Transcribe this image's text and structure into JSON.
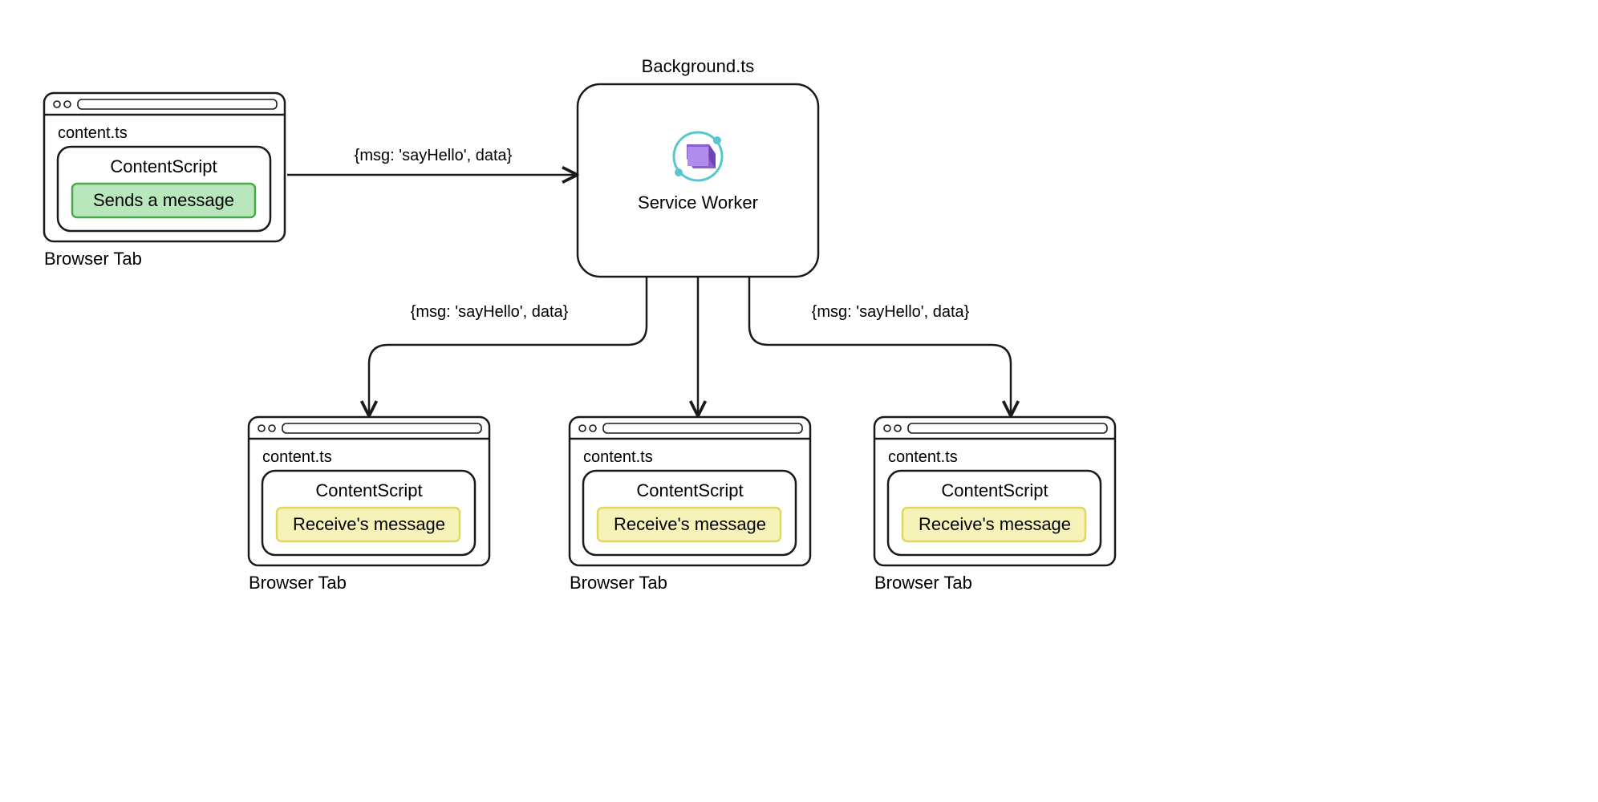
{
  "colors": {
    "stroke": "#1a1a1a",
    "sendBg": "#b8e7bc",
    "sendStroke": "#4aa84f",
    "recvBg": "#f5f3b8",
    "recvStroke": "#e0d860"
  },
  "sourceTab": {
    "file": "content.ts",
    "heading": "ContentScript",
    "badge": "Sends a message",
    "caption": "Browser Tab"
  },
  "background": {
    "file": "Background.ts",
    "label": "Service Worker"
  },
  "edgeTop": "{msg: 'sayHello', data}",
  "edgeLeft": "{msg: 'sayHello', data}",
  "edgeRight": "{msg: 'sayHello', data}",
  "receivers": [
    {
      "file": "content.ts",
      "heading": "ContentScript",
      "badge": "Receive's message",
      "caption": "Browser Tab"
    },
    {
      "file": "content.ts",
      "heading": "ContentScript",
      "badge": "Receive's message",
      "caption": "Browser Tab"
    },
    {
      "file": "content.ts",
      "heading": "ContentScript",
      "badge": "Receive's message",
      "caption": "Browser Tab"
    }
  ]
}
